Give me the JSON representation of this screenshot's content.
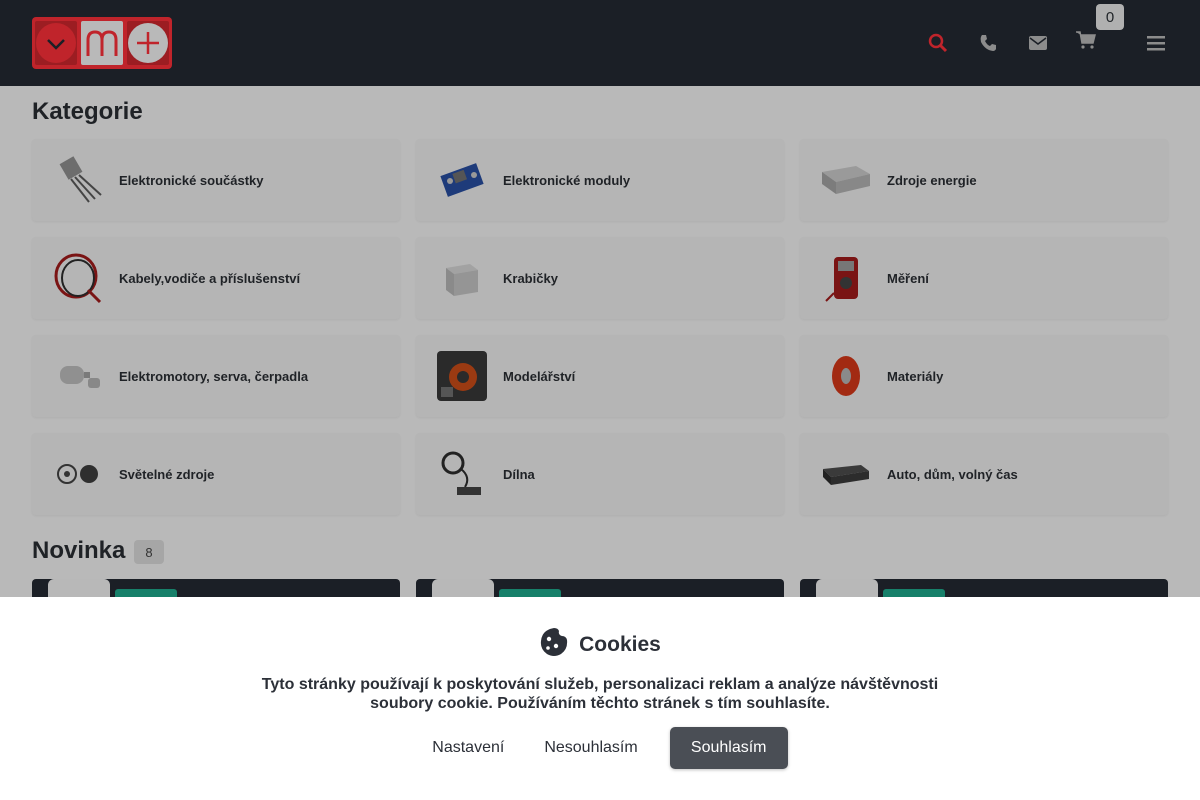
{
  "header": {
    "cart_count": "0",
    "accent_color": "#c0242b"
  },
  "categories_title": "Kategorie",
  "categories": [
    {
      "label": "Elektronické součástky",
      "icon": "transistor-icon"
    },
    {
      "label": "Elektronické moduly",
      "icon": "module-board-icon"
    },
    {
      "label": "Zdroje energie",
      "icon": "power-supply-icon"
    },
    {
      "label": "Kabely,vodiče a příslušenství",
      "icon": "cable-coil-icon"
    },
    {
      "label": "Krabičky",
      "icon": "enclosure-box-icon"
    },
    {
      "label": "Měření",
      "icon": "multimeter-icon"
    },
    {
      "label": "Elektromotory, serva, čerpadla",
      "icon": "motor-icon"
    },
    {
      "label": "Modelářství",
      "icon": "model-kit-icon"
    },
    {
      "label": "Materiály",
      "icon": "filament-spool-icon"
    },
    {
      "label": "Světelné zdroje",
      "icon": "led-icon"
    },
    {
      "label": "Dílna",
      "icon": "magnifier-stand-icon"
    },
    {
      "label": "Auto, dům, volný čas",
      "icon": "car-radio-icon"
    }
  ],
  "new_section": {
    "title": "Novinka",
    "count": "8"
  },
  "cookies": {
    "title": "Cookies",
    "text": "Tyto stránky používají k poskytování služeb, personalizaci reklam a analýze návštěvnosti soubory cookie. Používáním těchto stránek s tím souhlasíte.",
    "settings_label": "Nastavení",
    "decline_label": "Nesouhlasím",
    "accept_label": "Souhlasím"
  }
}
